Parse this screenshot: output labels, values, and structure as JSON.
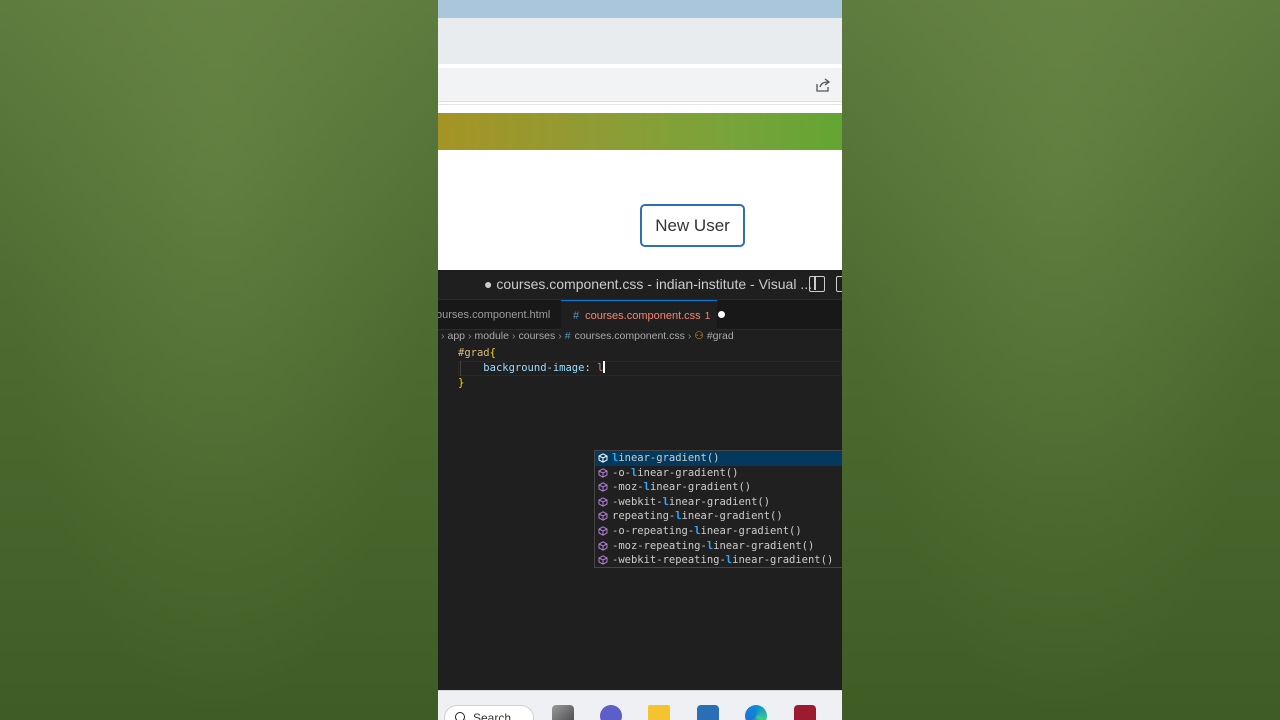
{
  "browser": {
    "share_icon": "share-icon",
    "gradient_colors": [
      "#a59425",
      "#63a533"
    ],
    "new_user_button": "New User"
  },
  "vscode": {
    "window_title": "● courses.component.css - indian-institute - Visual ...",
    "tabs": [
      {
        "label": "ourses.component.html",
        "active": false
      },
      {
        "label": "courses.component.css",
        "active": true,
        "problems": "1",
        "modified": true
      }
    ],
    "breadcrumb": {
      "items": [
        "app",
        "module",
        "courses",
        "courses.component.css",
        "#grad"
      ]
    },
    "code": {
      "line1_selector": "#grad",
      "line1_brace": "{",
      "line2_property": "background-image",
      "line2_colon": ":",
      "line2_typed": "l",
      "line3_brace": "}"
    },
    "suggestions": [
      {
        "pre": "",
        "hl": "l",
        "post": "inear-gradient()"
      },
      {
        "pre": "-o-",
        "hl": "l",
        "post": "inear-gradient()"
      },
      {
        "pre": "-moz-",
        "hl": "l",
        "post": "inear-gradient()"
      },
      {
        "pre": "-webkit-",
        "hl": "l",
        "post": "inear-gradient()"
      },
      {
        "pre": "repeating-",
        "hl": "l",
        "post": "inear-gradient()"
      },
      {
        "pre": "-o-repeating-",
        "hl": "l",
        "post": "inear-gradient()"
      },
      {
        "pre": "-moz-repeating-",
        "hl": "l",
        "post": "inear-gradient()"
      },
      {
        "pre": "-webkit-repeating-",
        "hl": "l",
        "post": "inear-gradient()"
      }
    ]
  },
  "taskbar": {
    "search_label": "Search",
    "apps": [
      "task-view-icon",
      "teams-icon",
      "file-explorer-icon",
      "store-icon",
      "edge-icon",
      "recorder-icon"
    ]
  }
}
